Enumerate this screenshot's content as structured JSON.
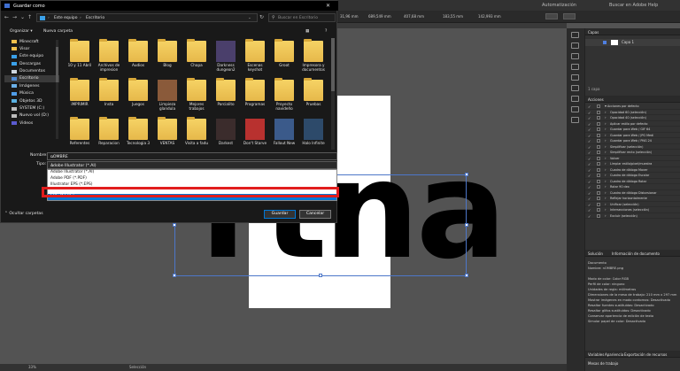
{
  "illustrator": {
    "top_right": [
      "Automatización",
      "Buscar en Adobe Help"
    ],
    "control_values": [
      "31,96 mm",
      "689,549 mm",
      "407,68 mm",
      "183,55 mm",
      "142,993 mm"
    ],
    "big_text": "rtna",
    "zoom": "33%",
    "status_tool": "Selección",
    "panels": {
      "capas_tab": "Capas",
      "layer_name": "Capa 1",
      "layer_count": "1 capa",
      "acciones_tab": "Acciones",
      "actions": [
        {
          "label": "Acciones por defecto",
          "folder": true
        },
        {
          "label": "Opacidad 60 (selección)"
        },
        {
          "label": "Opacidad 40 (selección)"
        },
        {
          "label": "Aplicar estilo por defecto"
        },
        {
          "label": "Guardar para Web / GIF 64"
        },
        {
          "label": "Guardar para Web / JPG Medi"
        },
        {
          "label": "Guardar para Web / PNG 24"
        },
        {
          "label": "Simplificar (selección)"
        },
        {
          "label": "Simplificar recto (selección)"
        },
        {
          "label": "Volver"
        },
        {
          "label": "Limpiar estilo/pixel/muestra"
        },
        {
          "label": "Cuadro de diálogo Mover"
        },
        {
          "label": "Cuadro de diálogo Escalar"
        },
        {
          "label": "Cuadro de diálogo Rotar"
        },
        {
          "label": "Rotar 90 dex"
        },
        {
          "label": "Cuadro de diálogo Distorsionar"
        },
        {
          "label": "Reflejar horizontalmente"
        },
        {
          "label": "Unificar (selección)"
        },
        {
          "label": "Intersecciones (selección)"
        },
        {
          "label": "Excluir (selección)"
        }
      ],
      "doc_tabs": [
        "Solución",
        "Información de documento"
      ],
      "doc_info": [
        "Documento",
        "Nombre: nOMBRE.png",
        "",
        "Modo de color: Color RGB",
        "Perfil de color: ninguno",
        "Unidades de regla: milímetros",
        "Dimensiones de la mesa de trabajo: 210 mm x 297 mm",
        "Mostrar imágenes en modo contornos: Desactivado",
        "Resaltar fuentes sustituidas: Desactivado",
        "Resaltar glifos sustituidos: Desactivado",
        "Conservar apariencia de edición de texto",
        "Simular papel de color: Desactivado"
      ],
      "bottom_tabs": [
        "Variables",
        "Apariencia",
        "Exportación de recursos"
      ],
      "bottom_sub": "Mesas de trabajo"
    }
  },
  "dialog": {
    "title": "Guardar como",
    "breadcrumb": [
      "Este equipo",
      "Escritorio"
    ],
    "search_placeholder": "Buscar en Escritorio",
    "organize_label": "Organizar ▾",
    "new_folder_label": "Nueva carpeta",
    "sidebar": [
      {
        "label": "Minecraft",
        "color": "#f1c04c"
      },
      {
        "label": "Visor",
        "color": "#f1c04c"
      },
      {
        "label": "Este equipo",
        "color": "#3aa0e8"
      },
      {
        "label": "Descargas",
        "color": "#3aa0e8"
      },
      {
        "label": "Documentos",
        "color": "#cfd6df"
      },
      {
        "label": "Escritorio",
        "color": "#4f8bd6",
        "active": true
      },
      {
        "label": "Imágenes",
        "color": "#6bb0e8"
      },
      {
        "label": "Música",
        "color": "#4f9de8"
      },
      {
        "label": "Objetos 3D",
        "color": "#5ab0e0"
      },
      {
        "label": "SYSTEM (C:)",
        "color": "#bcbcbc"
      },
      {
        "label": "Nuevo vol (D:)",
        "color": "#bcbcbc"
      },
      {
        "label": "Videos",
        "color": "#5b5bd0"
      }
    ],
    "files": [
      {
        "label": "10 y 11 Abril",
        "color": "#e6b84a",
        "folder": true
      },
      {
        "label": "Archivos de impresion",
        "color": "#e6b84a",
        "folder": true
      },
      {
        "label": "Audios",
        "color": "#e6b84a",
        "folder": true
      },
      {
        "label": "Blog",
        "color": "#e6b84a",
        "folder": true
      },
      {
        "label": "Chapa",
        "color": "#e6b84a",
        "folder": true
      },
      {
        "label": "Darkness dungeon2",
        "color": "#4a3f6b",
        "folder": false
      },
      {
        "label": "Escenas keyshot",
        "color": "#e6b84a",
        "folder": true
      },
      {
        "label": "Groot",
        "color": "#e6b84a",
        "folder": true
      },
      {
        "label": "Impresora y documentos",
        "color": "#e6b84a",
        "folder": true
      },
      {
        "label": "iMPRIMIR",
        "color": "#e6b84a",
        "folder": true
      },
      {
        "label": "Insta",
        "color": "#e6b84a",
        "folder": true
      },
      {
        "label": "Juegos",
        "color": "#e6b84a",
        "folder": true
      },
      {
        "label": "Limpieza glandula",
        "color": "#8a5a3a",
        "folder": false
      },
      {
        "label": "Mejores trabajos",
        "color": "#e6b84a",
        "folder": true
      },
      {
        "label": "Parcialito",
        "color": "#e6b84a",
        "folder": true
      },
      {
        "label": "Programas",
        "color": "#e6b84a",
        "folder": true
      },
      {
        "label": "Proyecto navideño",
        "color": "#e6b84a",
        "folder": true
      },
      {
        "label": "Pruebas",
        "color": "#e6b84a",
        "folder": true
      },
      {
        "label": "Referentes",
        "color": "#e6b84a",
        "folder": true
      },
      {
        "label": "Reparacion",
        "color": "#e6b84a",
        "folder": true
      },
      {
        "label": "Tecnologia 3",
        "color": "#e6b84a",
        "folder": true
      },
      {
        "label": "VENTAS",
        "color": "#e6b84a",
        "folder": true
      },
      {
        "label": "Visita a fadu",
        "color": "#e6b84a",
        "folder": true
      },
      {
        "label": "Darkest",
        "color": "#3b2c2c",
        "folder": false
      },
      {
        "label": "Don't Starve",
        "color": "#b8312f",
        "folder": false
      },
      {
        "label": "Fallout New",
        "color": "#3b5a8a",
        "folder": false
      },
      {
        "label": "Halo Infinite",
        "color": "#2d4a6a",
        "folder": false
      }
    ],
    "name_label": "Nombre:",
    "name_value": "nOMBRE",
    "type_label": "Tipo:",
    "type_value": "Adobe Illustrator (*.AI)",
    "type_options": [
      "Adobe Illustrator (*.AI)",
      "Adobe PDF (*.PDF)",
      "Illustrator EPS (*.EPS)",
      "",
      "SVG (*.SVG)",
      ""
    ],
    "selected_option_index": 4,
    "hide_folders": "Ocultar carpetas",
    "save_button": "Guardar",
    "cancel_button": "Cancelar"
  }
}
